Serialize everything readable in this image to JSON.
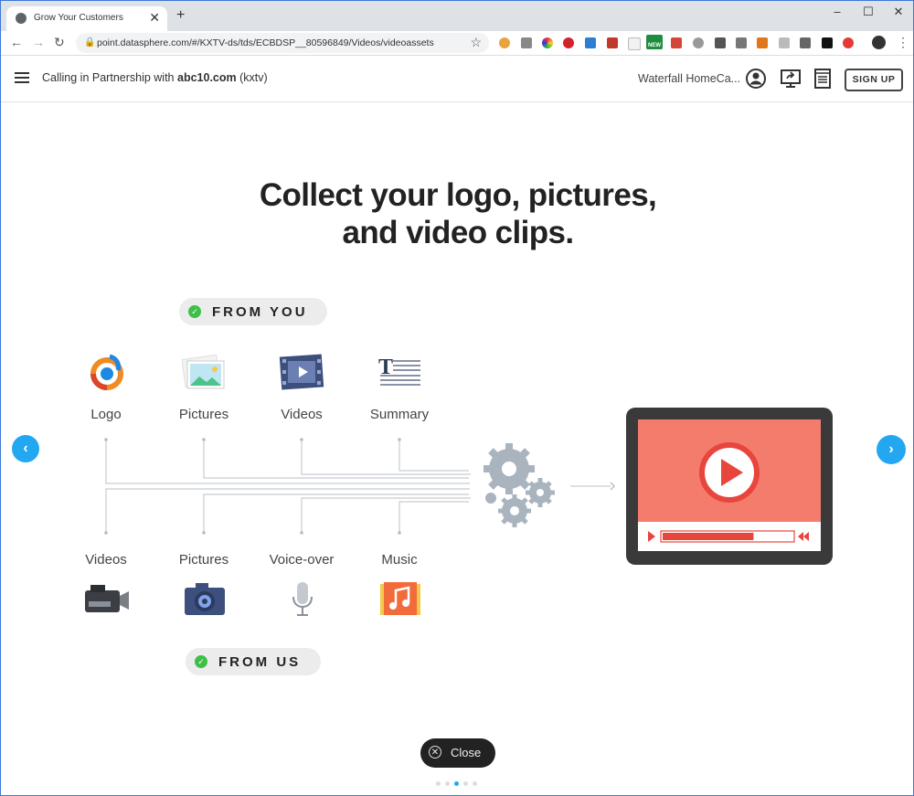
{
  "browser": {
    "tab_title": "Grow Your Customers",
    "new_tab_glyph": "+",
    "url": "point.datasphere.com/#/KXTV-ds/tds/ECBDSP__80596849/Videos/videoassets",
    "ext_badge_new": "NEW"
  },
  "header": {
    "partner_prefix": "Calling in Partnership with ",
    "partner_brand": "abc10.com",
    "partner_suffix": " (kxtv)",
    "business_name": "Waterfall HomeCa...",
    "signup_label": "SIGN UP"
  },
  "main": {
    "title_line1": "Collect your logo, pictures,",
    "title_line2": "and video clips.",
    "from_you_label": "FROM YOU",
    "from_us_label": "FROM US",
    "from_you_items": [
      "Logo",
      "Pictures",
      "Videos",
      "Summary"
    ],
    "from_us_items": [
      "Videos",
      "Pictures",
      "Voice-over",
      "Music"
    ],
    "close_label": "Close"
  },
  "pager": {
    "total": 5,
    "active_index": 2
  },
  "colors": {
    "accent": "#22a7f0",
    "check": "#3fbf4a",
    "video_screen": "#f47c6c",
    "video_red": "#e8453c",
    "tablet": "#3a3a3a",
    "gear": "#aab4be"
  }
}
